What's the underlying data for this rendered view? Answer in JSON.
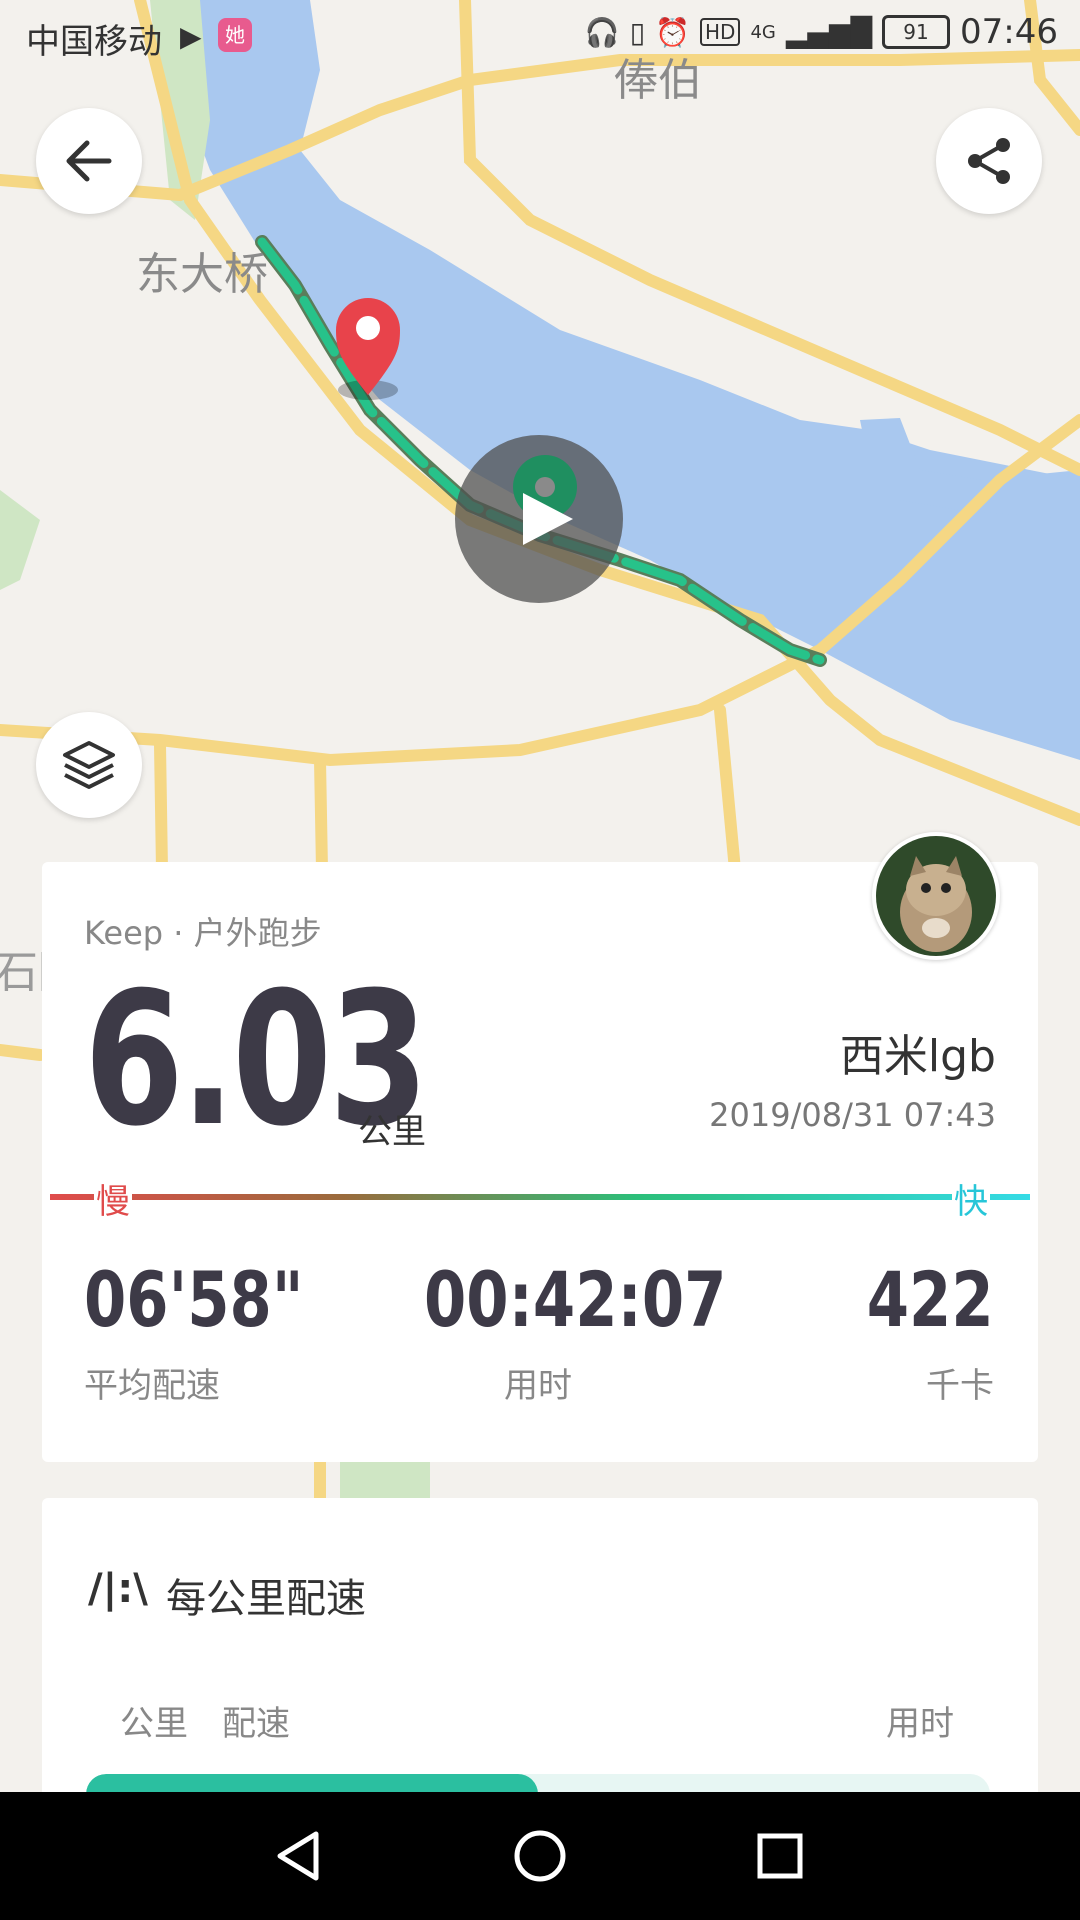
{
  "status_bar": {
    "carrier": "中国移动",
    "app_badge": "她",
    "hd": "HD",
    "network": "4G",
    "battery": "91",
    "time": "07:46"
  },
  "map": {
    "labels": [
      "东大桥",
      "俸伯",
      "石园"
    ],
    "water_color": "#a9c8ef",
    "route_color": "#27c28a",
    "road_color": "#f5d784"
  },
  "summary": {
    "source": "Keep · 户外跑步",
    "distance": "6.03",
    "distance_unit": "公里",
    "username": "西米lgb",
    "datetime": "2019/08/31 07:43",
    "slow_label": "慢",
    "fast_label": "快",
    "pace_value": "06'58\"",
    "pace_label": "平均配速",
    "duration_value": "00:42:07",
    "duration_label": "用时",
    "calories_value": "422",
    "calories_label": "千卡"
  },
  "pace_section": {
    "title": "每公里配速",
    "col_km": "公里",
    "col_pace": "配速",
    "col_time": "用时",
    "first_bar_fraction": 0.5
  }
}
